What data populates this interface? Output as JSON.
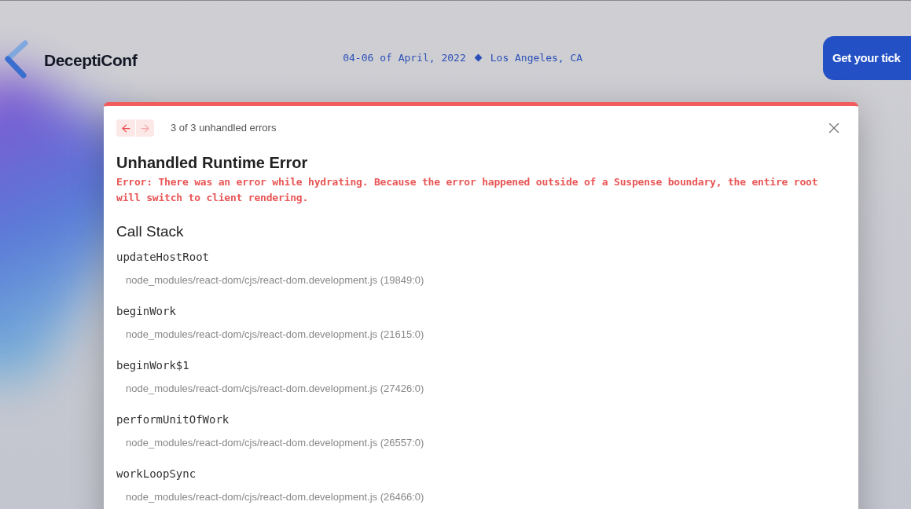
{
  "header": {
    "brand": "DeceptiConf",
    "date": "04-06 of April, 2022",
    "location": "Los Angeles, CA",
    "cta": "Get your tick"
  },
  "overlay": {
    "pager": {
      "buttons": [
        {
          "kind": "prev",
          "disabled": false
        },
        {
          "kind": "next",
          "disabled": true
        }
      ],
      "label": "3 of 3 unhandled errors"
    },
    "title": "Unhandled Runtime Error",
    "message": "Error: There was an error while hydrating. Because the error happened outside of a Suspense boundary, the entire root will switch to client rendering.",
    "stack_title": "Call Stack",
    "frames": [
      {
        "function": "updateHostRoot",
        "location": "node_modules/react-dom/cjs/react-dom.development.js (19849:0)"
      },
      {
        "function": "beginWork",
        "location": "node_modules/react-dom/cjs/react-dom.development.js (21615:0)"
      },
      {
        "function": "beginWork$1",
        "location": "node_modules/react-dom/cjs/react-dom.development.js (27426:0)"
      },
      {
        "function": "performUnitOfWork",
        "location": "node_modules/react-dom/cjs/react-dom.development.js (26557:0)"
      },
      {
        "function": "workLoopSync",
        "location": "node_modules/react-dom/cjs/react-dom.development.js (26466:0)"
      }
    ]
  }
}
